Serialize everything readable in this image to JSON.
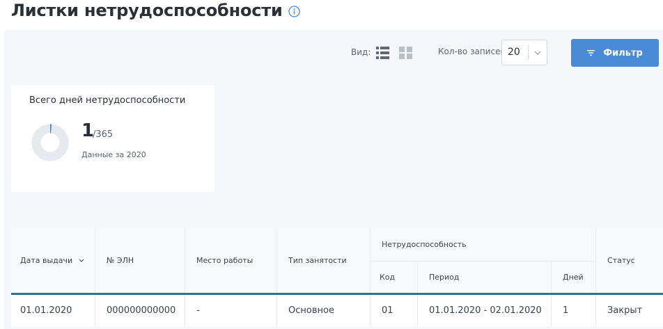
{
  "page": {
    "title": "Листки нетрудоспособности"
  },
  "toolbar": {
    "view_label": "Вид:",
    "per_page_label": "Кол-во записей",
    "per_page_value": "20",
    "filter_label": "Фильтр"
  },
  "stats": {
    "title": "Всего дней нетрудоспособности",
    "value": "1",
    "total": "/365",
    "subtitle": "Данные за 2020",
    "fraction": 0.00274,
    "accent_color": "#3f7fd0"
  },
  "table": {
    "headers": {
      "issue_date": "Дата выдачи",
      "eln_number": "№ ЭЛН",
      "workplace": "Место работы",
      "employment_type": "Тип занятости",
      "disability_group": "Нетрудоспособность",
      "code": "Код",
      "period": "Период",
      "days": "Дней",
      "status": "Статус"
    },
    "rows": [
      {
        "issue_date": "01.01.2020",
        "eln_number": "000000000000",
        "workplace": "-",
        "employment_type": "Основное",
        "code": "01",
        "period": "01.01.2020 - 02.01.2020",
        "days": "1",
        "status": "Закрыт"
      }
    ]
  },
  "colors": {
    "primary_button": "#4a8bd6",
    "table_accent_line": "#1f7b86",
    "panel_background": "#f5f7fa"
  }
}
